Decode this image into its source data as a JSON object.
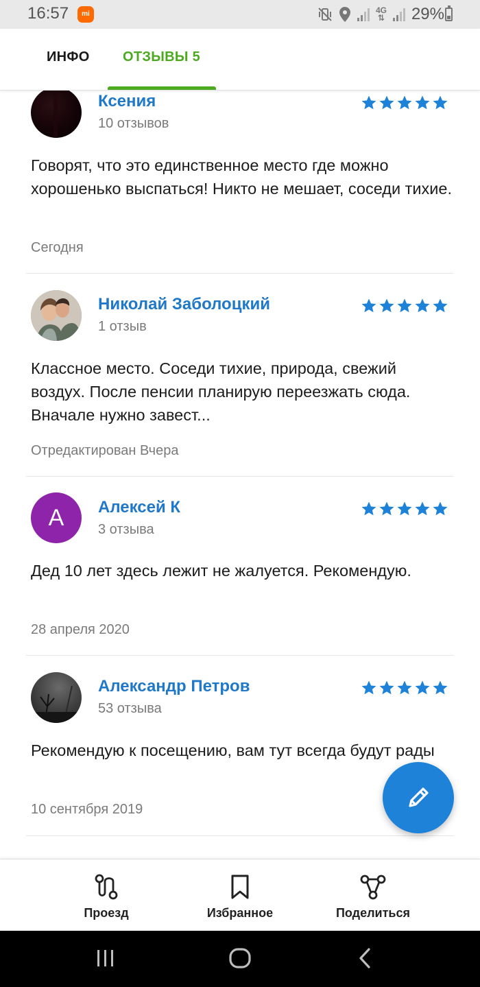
{
  "status_bar": {
    "time": "16:57",
    "mi_badge": "mi",
    "network": "4G",
    "battery_percent": "29%",
    "icons": [
      "mute-vibrate-icon",
      "location-icon",
      "signal-icon",
      "network-4g-icon",
      "signal-icon",
      "battery-icon"
    ]
  },
  "tabs": [
    {
      "label": "ИНФО",
      "active": false
    },
    {
      "label": "ОТЗЫВЫ 5",
      "active": true
    }
  ],
  "colors": {
    "accent_green": "#4caa1f",
    "name_blue": "#1f78c8",
    "star_blue": "#1e82d8",
    "fab_blue": "#1e82d8",
    "avatar_purple": "#8e24aa"
  },
  "reviews": [
    {
      "name": "Ксения",
      "count": "10 отзывов",
      "rating": 5,
      "text": "Говорят, что это единственное место где можно хорошенько выспаться! Никто не мешает, соседи тихие.",
      "date": "Сегодня",
      "avatar": "dark-photo"
    },
    {
      "name": "Николай Заболоцкий",
      "count": "1 отзыв",
      "rating": 5,
      "text": "Классное место. Соседи тихие, природа, свежий воздух. После пенсии планирую переезжать сюда. Вначале нужно завест...",
      "date": "Отредактирован Вчера",
      "avatar": "couple-photo"
    },
    {
      "name": "Алексей К",
      "count": "3 отзыва",
      "rating": 5,
      "text": "Дед 10 лет здесь лежит не жалуется. Рекомендую.",
      "date": "28 апреля 2020",
      "avatar_letter": "А"
    },
    {
      "name": "Александр Петров",
      "count": "53 отзыва",
      "rating": 5,
      "text": "Рекомендую к посещению, вам тут всегда будут рады",
      "date": "10 сентября 2019",
      "avatar": "night-tree-photo"
    }
  ],
  "fab": {
    "icon": "pencil-icon"
  },
  "actions": [
    {
      "label": "Проезд",
      "icon": "route-icon"
    },
    {
      "label": "Избранное",
      "icon": "bookmark-icon"
    },
    {
      "label": "Поделиться",
      "icon": "share-icon"
    }
  ],
  "nav_bar": {
    "buttons": [
      "recents-icon",
      "home-icon",
      "back-icon"
    ]
  }
}
